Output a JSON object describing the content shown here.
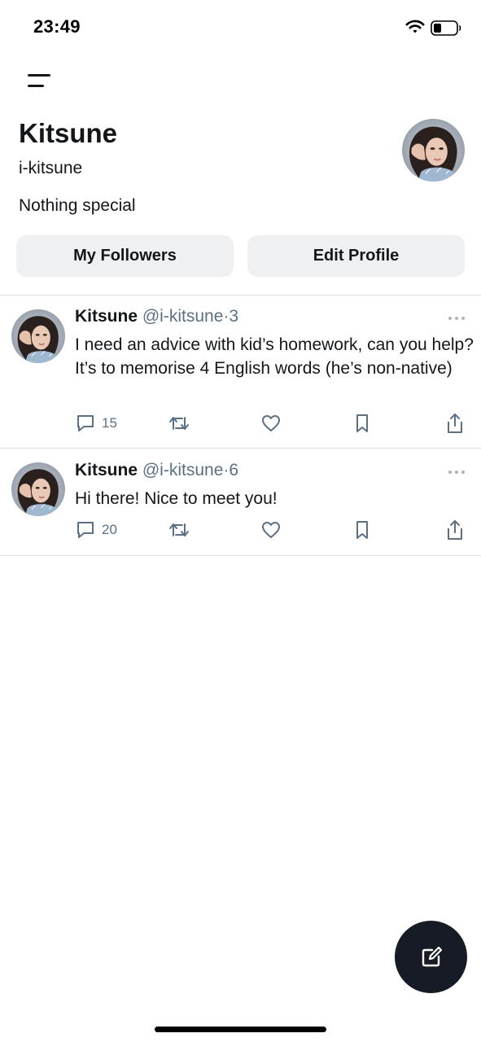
{
  "status_bar": {
    "time": "23:49",
    "wifi_icon": "wifi-icon",
    "battery_icon": "battery-icon"
  },
  "top_bar": {
    "menu_icon": "menu-icon"
  },
  "profile": {
    "name": "Kitsune",
    "handle": "i-kitsune",
    "bio": "Nothing special",
    "avatar_icon": "avatar",
    "followers_button": "My Followers",
    "edit_button": "Edit Profile"
  },
  "tweets": [
    {
      "author": "Kitsune",
      "username": "@i-kitsune",
      "dot": "·",
      "time": "3",
      "text": "I need an advice with kid’s homework, can you help? It’s to memorise 4 English words (he’s non-native)",
      "reply_count": "15"
    },
    {
      "author": "Kitsune",
      "username": "@i-kitsune",
      "dot": "·",
      "time": "6",
      "text": "Hi there! Nice to meet you!",
      "reply_count": "20"
    }
  ],
  "compose": {
    "icon": "compose-icon"
  },
  "colors": {
    "text_primary": "#14171a",
    "text_secondary": "#5b7083",
    "button_bg": "#eff0f2",
    "fab_bg": "#161b26",
    "divider": "#dcdfe3"
  }
}
